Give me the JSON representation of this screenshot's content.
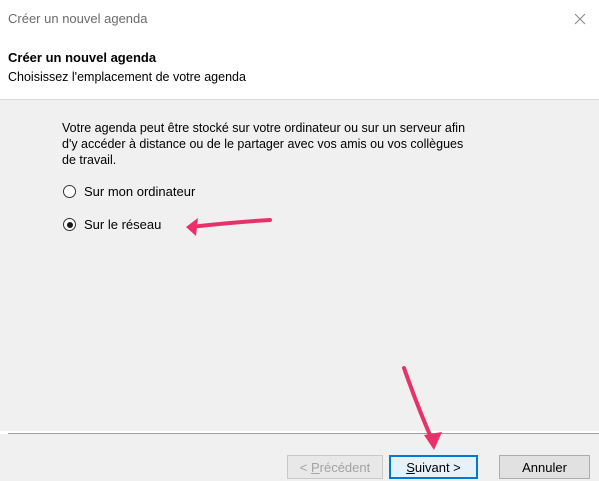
{
  "window": {
    "title": "Créer un nouvel agenda",
    "close_icon": "close-icon"
  },
  "header": {
    "title": "Créer un nouvel agenda",
    "subtitle": "Choisissez l'emplacement de votre agenda"
  },
  "content": {
    "description_lines": [
      "Votre agenda peut être stocké sur votre ordinateur ou sur un serveur afin",
      "d'y accéder à distance ou de le partager avec vos amis ou vos collègues",
      "de travail."
    ],
    "options": [
      {
        "label": "Sur mon ordinateur",
        "selected": false
      },
      {
        "label": "Sur le réseau",
        "selected": true
      }
    ]
  },
  "footer": {
    "previous": {
      "prefix": "< ",
      "accel": "P",
      "rest": "récédent",
      "enabled": false
    },
    "next": {
      "accel": "S",
      "rest": "uivant >",
      "enabled": true
    },
    "cancel": {
      "label": "Annuler",
      "enabled": true
    }
  },
  "colors": {
    "annotation_arrow": "#e8316a",
    "dialog_background": "#f0f0f0",
    "primary_border": "#0078d7"
  }
}
